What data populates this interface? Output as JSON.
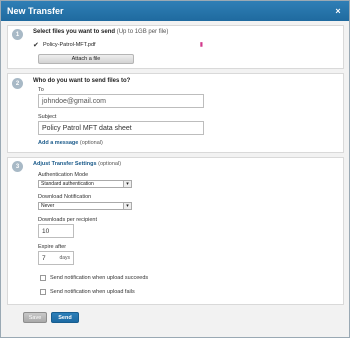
{
  "dialog": {
    "title": "New Transfer",
    "close_glyph": "×"
  },
  "section1": {
    "number": "1",
    "heading": "Select files you want to send",
    "note": "(Up to 1GB per file)",
    "file_name": "Policy-Patrol-MFT.pdf",
    "attach_label": "Attach a file"
  },
  "section2": {
    "number": "2",
    "heading": "Who do you want to send files to?",
    "to_label": "To",
    "to_placeholder": "johndoe@gmail.com",
    "subject_label": "Subject",
    "subject_value": "Policy Patrol MFT data sheet",
    "add_message_label": "Add a message",
    "add_message_note": "(optional)"
  },
  "section3": {
    "number": "3",
    "heading": "Adjust Transfer Settings",
    "note": "(optional)",
    "auth_label": "Authentication Mode",
    "auth_value": "Standard authentication",
    "download_notify_label": "Download Notification",
    "download_notify_value": "Never",
    "downloads_per_recipient_label": "Downloads per recipient",
    "downloads_per_recipient_value": "10",
    "expire_label": "Expire after",
    "expire_value": "7",
    "expire_unit": "days",
    "notify_upload_success_label": "Send notification when upload succeeds",
    "notify_upload_fail_label": "Send notification when upload fails"
  },
  "footer": {
    "save_label": "Save",
    "send_label": "Send"
  },
  "colors": {
    "titlebar": "#2573aa",
    "send_button": "#1f6ea8",
    "delete_icon": "#d23a8c"
  },
  "icons": {
    "close": "close-icon",
    "check": "checkmark-icon",
    "delete": "delete-file-icon",
    "dropdown": "chevron-down-icon"
  }
}
